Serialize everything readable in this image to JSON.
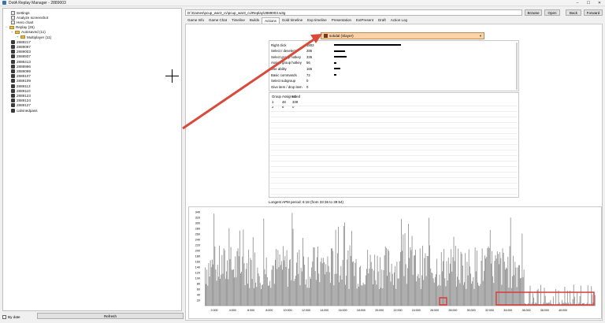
{
  "window": {
    "title": "DotA Replay Manager - 2889003",
    "controls": [
      "–",
      "☐",
      "✕"
    ]
  },
  "tree": {
    "items": [
      {
        "label": "Settings",
        "icon": "settings-icon",
        "indent": 1
      },
      {
        "label": "Analyze screenshot",
        "icon": "screenshot-icon",
        "indent": 1
      },
      {
        "label": "Hero chart",
        "icon": "chart-icon",
        "indent": 1
      },
      {
        "label": "Replay (26)",
        "icon": "folder-icon",
        "indent": 0,
        "expander": "−"
      },
      {
        "label": "Autosaved (11)",
        "icon": "folder-icon",
        "indent": 1,
        "expander": "+"
      },
      {
        "label": "Multiplayer (11)",
        "icon": "folder-icon",
        "indent": 2,
        "expander": "+"
      },
      {
        "label": "2889217",
        "icon": "replay-icon",
        "indent": 1
      },
      {
        "label": "2889097",
        "icon": "replay-icon",
        "indent": 1
      },
      {
        "label": "2889003",
        "icon": "replay-icon",
        "indent": 1
      },
      {
        "label": "2888937",
        "icon": "replay-icon",
        "indent": 1
      },
      {
        "label": "2888413",
        "icon": "replay-icon",
        "indent": 1
      },
      {
        "label": "2888996",
        "icon": "replay-icon",
        "indent": 1
      },
      {
        "label": "2889099",
        "icon": "replay-icon",
        "indent": 1
      },
      {
        "label": "2889107",
        "icon": "replay-icon",
        "indent": 1
      },
      {
        "label": "2889109",
        "icon": "replay-icon",
        "indent": 1
      },
      {
        "label": "2889113",
        "icon": "replay-icon",
        "indent": 1
      },
      {
        "label": "2889110",
        "icon": "replay-icon",
        "indent": 1
      },
      {
        "label": "2889123",
        "icon": "replay-icon",
        "indent": 1
      },
      {
        "label": "2889124",
        "icon": "replay-icon",
        "indent": 1
      },
      {
        "label": "2889127",
        "icon": "replay-icon",
        "indent": 1
      },
      {
        "label": "calvinedpass",
        "icon": "replay-icon",
        "indent": 1
      }
    ],
    "by_date_label": "By date",
    "refresh_label": "Refresh"
  },
  "toolbar": {
    "path": "D:\\Games\\pcup_war3_cv\\pcup_war3_cv\\Replay\\2889003.w3g",
    "browse": "Browse",
    "open": "Open",
    "back": "Back",
    "forward": "Forward"
  },
  "tabs": [
    "Game Info",
    "Game Chat",
    "Timeline",
    "Builds",
    "Actions",
    "Gold timeline",
    "Exp timeline",
    "Presentation",
    "ExtPresent",
    "Draft",
    "Action Log"
  ],
  "active_tab": "Actions",
  "player": {
    "name": "sokdal (Slayer)"
  },
  "actions": [
    {
      "name": "Right click",
      "value": "1803",
      "frac": 1.0
    },
    {
      "name": "Select / deselect",
      "value": "286",
      "frac": 0.16
    },
    {
      "name": "Select group hotkey",
      "value": "335",
      "frac": 0.19
    },
    {
      "name": "Assign group hotkey",
      "value": "56",
      "frac": 0.03
    },
    {
      "name": "Use ability",
      "value": "165",
      "frac": 0.09
    },
    {
      "name": "Basic commands",
      "value": "72",
      "frac": 0.04
    },
    {
      "name": "Select subgroup",
      "value": "0",
      "frac": 0
    },
    {
      "name": "Give item / drop item",
      "value": "0",
      "frac": 0
    }
  ],
  "groups": {
    "headers": [
      "Group",
      "Assigned",
      "Used"
    ],
    "rows": [
      [
        "1",
        "48",
        "339"
      ],
      [
        "2",
        "8",
        "0"
      ]
    ]
  },
  "longest_apm": "Longest APM period: 6:18 (from 33:36 to 39:54)",
  "chart_data": {
    "type": "bar",
    "ylim": [
      0,
      340
    ],
    "yticks": [
      "340",
      "320",
      "300",
      "280",
      "260",
      "240",
      "220",
      "200",
      "180",
      "160",
      "140",
      "120",
      "100",
      "80",
      "60",
      "40",
      "20"
    ],
    "xticks": [
      "2:000",
      "4:000",
      "6:000",
      "8:000",
      "10:000",
      "12:000",
      "14:000",
      "16:000",
      "18:000",
      "20:000",
      "22:000",
      "24:000",
      "26:000",
      "28:000",
      "30:000",
      "32:000",
      "34:000",
      "36:000",
      "38:000",
      "40:000"
    ],
    "bar_color": "#888888",
    "annotation_color": "#d93a3a"
  },
  "colors": {
    "arrow": "#d94a3a",
    "player_bg": "#fcd3a9"
  }
}
